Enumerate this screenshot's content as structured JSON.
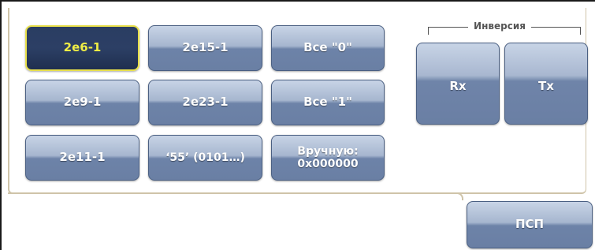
{
  "pattern_buttons": [
    {
      "label": "2e6-1",
      "selected": true
    },
    {
      "label": "2e15-1",
      "selected": false
    },
    {
      "label": "Все \"0\"",
      "selected": false
    },
    {
      "label": "2e9-1",
      "selected": false
    },
    {
      "label": "2e23-1",
      "selected": false
    },
    {
      "label": "Все \"1\"",
      "selected": false
    },
    {
      "label": "2e11-1",
      "selected": false
    },
    {
      "label": "‘55’ (0101…)",
      "selected": false
    },
    {
      "label": "Вручную:\n0x000000",
      "selected": false
    }
  ],
  "inversion": {
    "title": "Инверсия",
    "rx_label": "Rx",
    "tx_label": "Tx"
  },
  "bottom_tab": {
    "label": "ПСП"
  },
  "colors": {
    "button_blue": "#6a7fa4",
    "selected_bg": "#2a3d62",
    "selected_text": "#f0ee45",
    "panel_border": "#cfc4a9"
  }
}
